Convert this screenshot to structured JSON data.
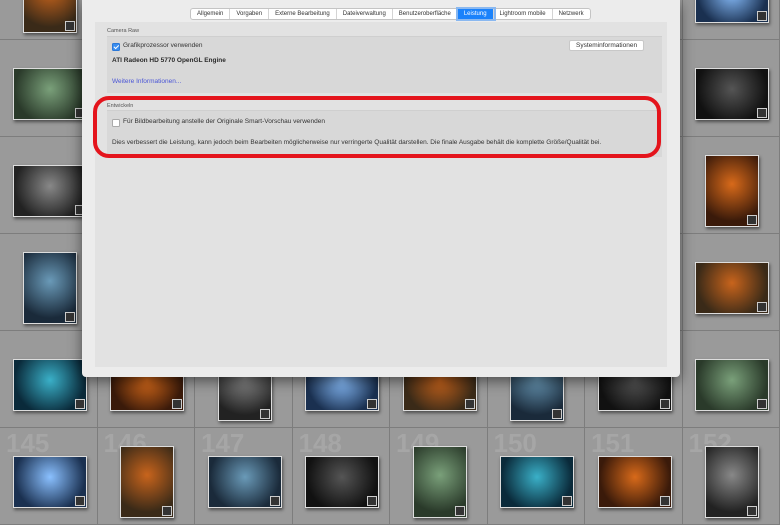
{
  "dialog": {
    "tabs": [
      {
        "label": "Allgemein",
        "active": false
      },
      {
        "label": "Vorgaben",
        "active": false
      },
      {
        "label": "Externe Bearbeitung",
        "active": false
      },
      {
        "label": "Dateiverwaltung",
        "active": false
      },
      {
        "label": "Benutzeroberfläche",
        "active": false
      },
      {
        "label": "Leistung",
        "active": true
      },
      {
        "label": "Lightroom mobile",
        "active": false
      },
      {
        "label": "Netzwerk",
        "active": false
      }
    ],
    "camera_raw": {
      "title": "Camera Raw",
      "gpu_checkbox_label": "Grafikprozessor verwenden",
      "gpu_checked": true,
      "gpu_name": "ATI Radeon HD 5770 OpenGL Engine",
      "system_info_button": "Systeminformationen",
      "more_info_link": "Weitere Informationen..."
    },
    "develop": {
      "title": "Entwickeln",
      "smart_preview_checkbox_label": "Für Bildbearbeitung anstelle der Originale Smart-Vorschau verwenden",
      "smart_preview_checked": false,
      "description": "Dies verbessert die Leistung, kann jedoch beim Bearbeiten möglicherweise nur verringerte Qualität darstellen. Die finale Ausgabe behält die komplette Größe/Qualität bei."
    },
    "highlight_color": "#e4141c"
  },
  "grid": {
    "bottom_row_numbers": [
      "145",
      "146",
      "147",
      "148",
      "149",
      "150",
      "151",
      "152"
    ]
  }
}
